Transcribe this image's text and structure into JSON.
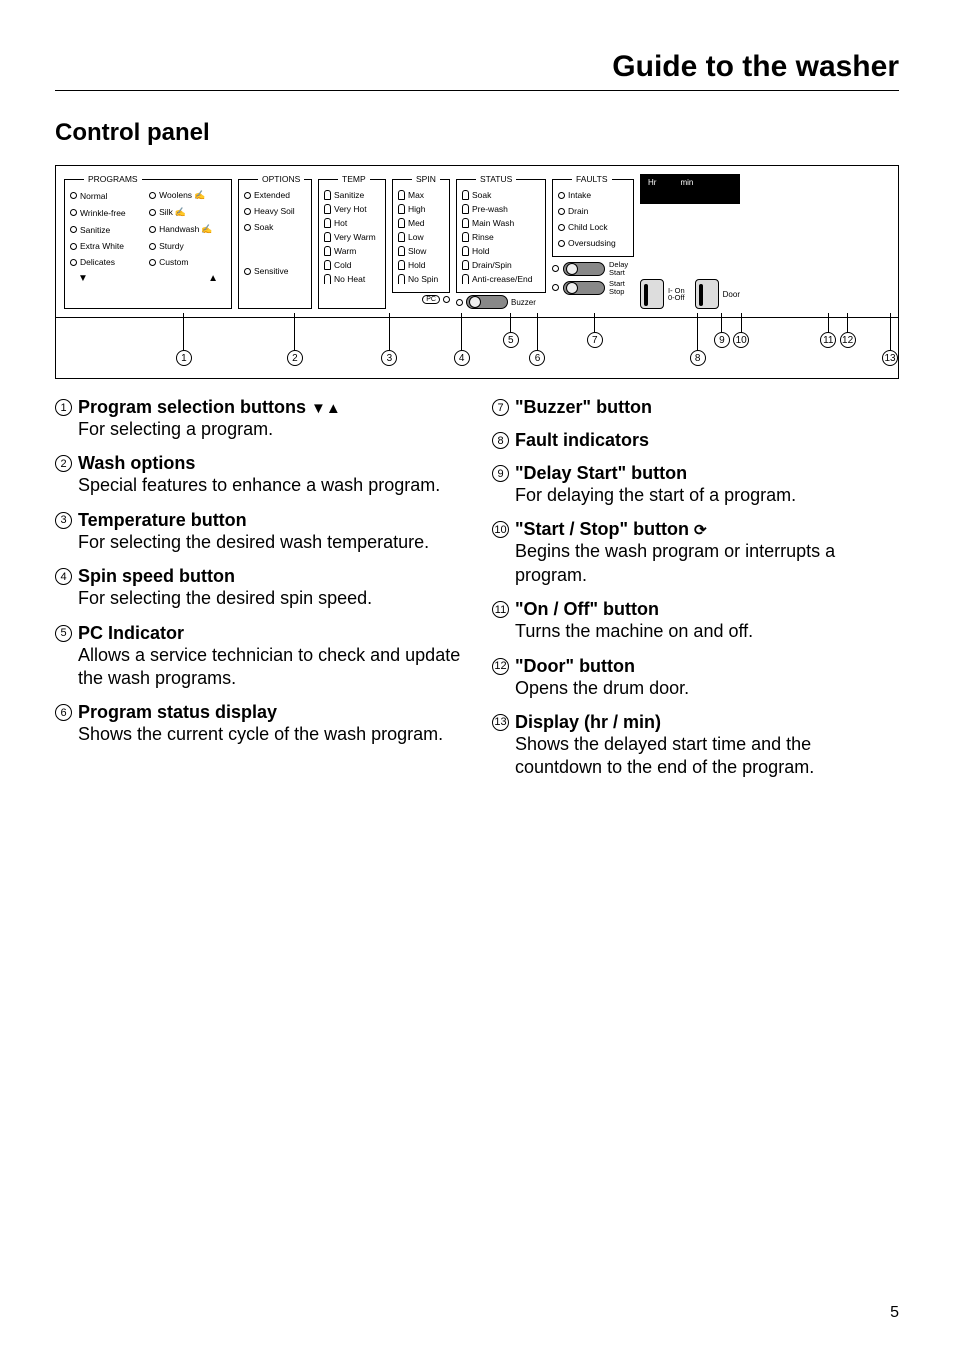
{
  "page_title": "Guide to the washer",
  "section_title": "Control panel",
  "page_number": "5",
  "panel": {
    "programs": {
      "label": "PROGRAMS",
      "items_left": [
        "Normal",
        "Wrinkle-free",
        "Sanitize",
        "Extra White",
        "Delicates"
      ],
      "items_right": [
        "Woolens",
        "Silk",
        "Handwash",
        "Sturdy",
        "Custom"
      ],
      "hand_indices_right": [
        0,
        1,
        2
      ],
      "down": "▼",
      "up": "▲"
    },
    "options": {
      "label": "OPTIONS",
      "items": [
        "Extended",
        "Heavy Soil",
        "Soak",
        "Sensitive"
      ]
    },
    "temp": {
      "label": "TEMP",
      "items": [
        "Sanitize",
        "Very Hot",
        "Hot",
        "Very Warm",
        "Warm",
        "Cold",
        "No Heat"
      ]
    },
    "spin": {
      "label": "SPIN",
      "items": [
        "Max",
        "High",
        "Med",
        "Low",
        "Slow",
        "Hold",
        "No Spin"
      ]
    },
    "status": {
      "label": "STATUS",
      "items": [
        "Soak",
        "Pre-wash",
        "Main Wash",
        "Rinse",
        "Hold",
        "Drain/Spin",
        "Anti-crease/End"
      ],
      "buzzer": "Buzzer",
      "pc": "PC"
    },
    "faults": {
      "label": "FAULTS",
      "items": [
        "Intake",
        "Drain",
        "Child Lock",
        "Oversudsing"
      ]
    },
    "delay": {
      "l1": "Delay",
      "l2": "Start"
    },
    "startstop": {
      "l1": "Start",
      "l2": "Stop"
    },
    "onoff": {
      "l1": "I- On",
      "l2": "0-Off"
    },
    "door": "Door",
    "display": {
      "hr": "Hr",
      "min": "min"
    }
  },
  "callouts": [
    "1",
    "2",
    "3",
    "4",
    "5",
    "6",
    "7",
    "8",
    "9",
    "10",
    "11",
    "12",
    "13"
  ],
  "legend_left": [
    {
      "n": "1",
      "title": "Program selection buttons",
      "sym": "▼▲",
      "desc": "For selecting a program."
    },
    {
      "n": "2",
      "title": "Wash options",
      "desc": "Special features to enhance a wash program."
    },
    {
      "n": "3",
      "title": "Temperature button",
      "desc": "For selecting the desired wash temperature."
    },
    {
      "n": "4",
      "title": "Spin speed button",
      "desc": "For selecting the desired spin speed."
    },
    {
      "n": "5",
      "title": "PC Indicator",
      "desc": "Allows a service technician to check and update the wash programs."
    },
    {
      "n": "6",
      "title": "Program status display",
      "desc": "Shows the current cycle of the wash program."
    }
  ],
  "legend_right": [
    {
      "n": "7",
      "title": "\"Buzzer\" button"
    },
    {
      "n": "8",
      "title": "Fault indicators"
    },
    {
      "n": "9",
      "title": "\"Delay Start\" button",
      "desc": "For delaying the start of a program."
    },
    {
      "n": "10",
      "title": "\"Start / Stop\" button",
      "sym": "⟳",
      "desc": "Begins the wash program or interrupts a program."
    },
    {
      "n": "11",
      "title": "\"On / Off\" button",
      "desc": "Turns the machine on and off."
    },
    {
      "n": "12",
      "title": "\"Door\" button",
      "desc": "Opens the drum door."
    },
    {
      "n": "13",
      "title": "Display (hr / min)",
      "desc": "Shows the delayed start time and the countdown to the end of the program."
    }
  ]
}
